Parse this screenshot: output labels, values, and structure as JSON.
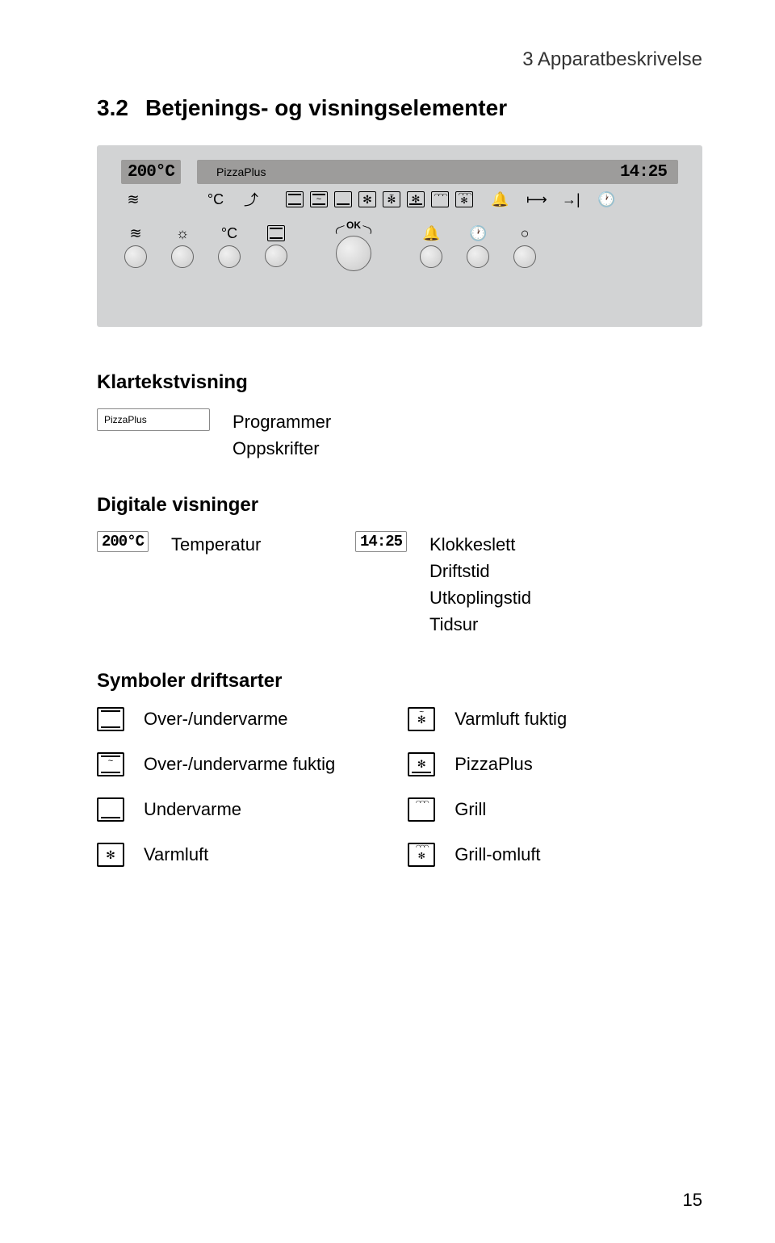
{
  "header": {
    "chapter": "3  Apparatbeskrivelse"
  },
  "section": {
    "number": "3.2",
    "title": "Betjenings- og visningselementer"
  },
  "panel": {
    "temp_display": "200°C",
    "brand": "PizzaPlus",
    "time_display": "14:25",
    "deg_c": "°C",
    "ok_label": "OK"
  },
  "klartekst": {
    "heading": "Klartekstvisning",
    "lcd_brand": "PizzaPlus",
    "desc1": "Programmer",
    "desc2": "Oppskrifter"
  },
  "digital": {
    "heading": "Digitale visninger",
    "temp_lcd": "200°C",
    "temp_label": "Temperatur",
    "time_lcd": "14:25",
    "d1": "Klokkeslett",
    "d2": "Driftstid",
    "d3": "Utkoplingstid",
    "d4": "Tidsur"
  },
  "symbols": {
    "heading": "Symboler driftsarter",
    "left": [
      "Over-/undervarme",
      "Over-/undervarme fuktig",
      "Undervarme",
      "Varmluft"
    ],
    "right": [
      "Varmluft fuktig",
      "PizzaPlus",
      "Grill",
      "Grill-omluft"
    ]
  },
  "page_number": "15"
}
